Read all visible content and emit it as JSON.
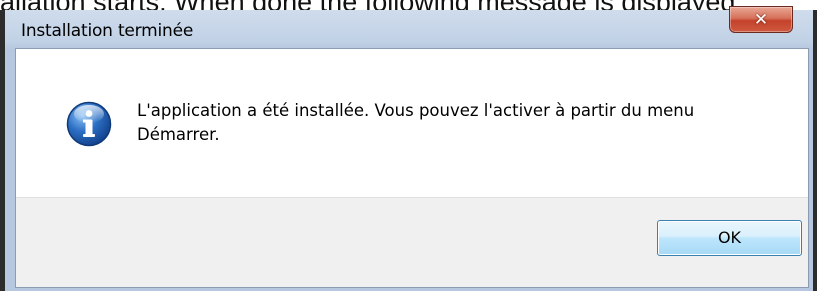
{
  "document": {
    "visible_text_fragment": "allation starts. When done the following message is displayed:"
  },
  "dialog": {
    "title": "Installation terminée",
    "close_glyph": "✕",
    "icon": "information-icon",
    "message": "L'application a été installée. Vous pouvez l'activer à partir du menu Démarrer.",
    "ok_label": "OK"
  },
  "colors": {
    "close_button": "#c4412a",
    "frame": "#2c2c2c",
    "titlebar": "#c2d2e6",
    "footer": "#f0f0f0",
    "ok_button": "#bee6fd",
    "info_icon": "#2c6fc4"
  }
}
